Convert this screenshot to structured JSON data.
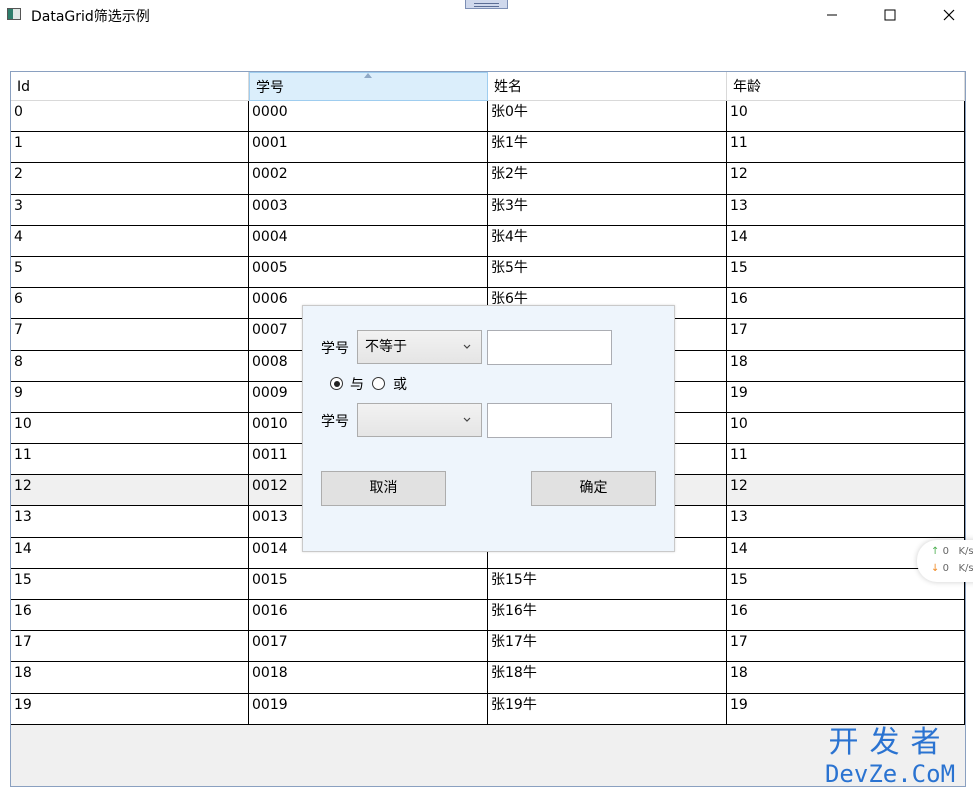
{
  "window": {
    "title": "DataGrid筛选示例"
  },
  "grid": {
    "columns": [
      "Id",
      "学号",
      "姓名",
      "年龄"
    ],
    "rows": [
      [
        "0",
        "0000",
        "张0牛",
        "10"
      ],
      [
        "1",
        "0001",
        "张1牛",
        "11"
      ],
      [
        "2",
        "0002",
        "张2牛",
        "12"
      ],
      [
        "3",
        "0003",
        "张3牛",
        "13"
      ],
      [
        "4",
        "0004",
        "张4牛",
        "14"
      ],
      [
        "5",
        "0005",
        "张5牛",
        "15"
      ],
      [
        "6",
        "0006",
        "张6牛",
        "16"
      ],
      [
        "7",
        "0007",
        "",
        "17"
      ],
      [
        "8",
        "0008",
        "",
        "18"
      ],
      [
        "9",
        "0009",
        "",
        "19"
      ],
      [
        "10",
        "0010",
        "",
        "10"
      ],
      [
        "11",
        "0011",
        "",
        "11"
      ],
      [
        "12",
        "0012",
        "",
        "12"
      ],
      [
        "13",
        "0013",
        "",
        "13"
      ],
      [
        "14",
        "0014",
        "",
        "14"
      ],
      [
        "15",
        "0015",
        "张15牛",
        "15"
      ],
      [
        "16",
        "0016",
        "张16牛",
        "16"
      ],
      [
        "17",
        "0017",
        "张17牛",
        "17"
      ],
      [
        "18",
        "0018",
        "张18牛",
        "18"
      ],
      [
        "19",
        "0019",
        "张19牛",
        "19"
      ]
    ]
  },
  "filter_popup": {
    "field1_label": "学号",
    "op1_selected": "不等于",
    "value1": "",
    "logic_and_label": "与",
    "logic_or_label": "或",
    "logic_selected": "与",
    "field2_label": "学号",
    "op2_selected": "",
    "value2": "",
    "cancel_label": "取消",
    "ok_label": "确定"
  },
  "speed_widget": {
    "up_value": "0",
    "up_unit": "K/s",
    "down_value": "0",
    "down_unit": "K/s"
  },
  "watermark": {
    "cn": "开发者",
    "en": "DevZe.CoM"
  },
  "colors": {
    "popup_bg": "#eef5fc",
    "sorted_header_bg": "#dbeefb",
    "watermark": "#2a73d1"
  }
}
